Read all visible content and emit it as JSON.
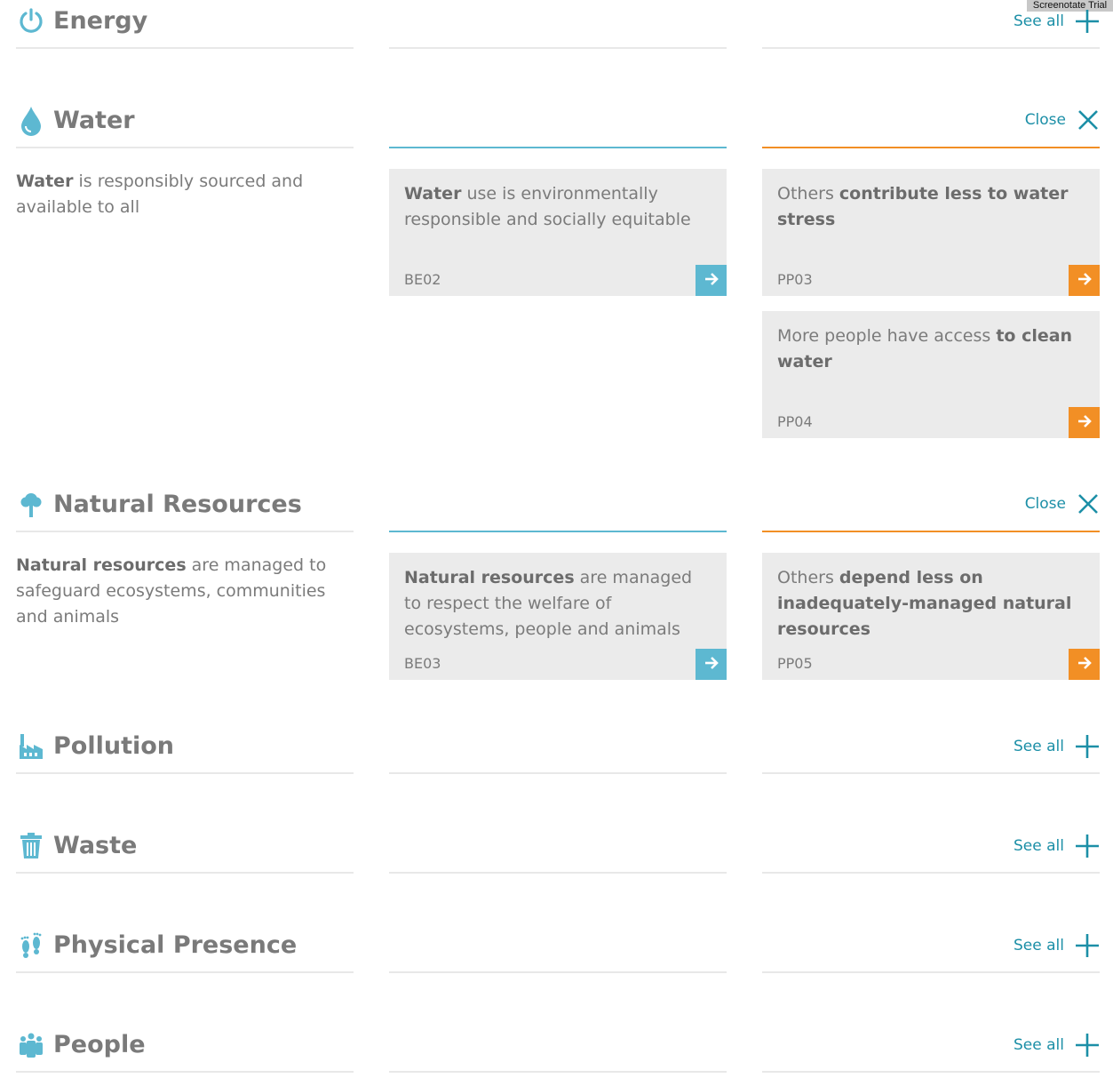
{
  "watermark": "Screenotate Trial",
  "sections": {
    "energy": {
      "title": "Energy",
      "action": "See all",
      "icon": "power-icon"
    },
    "water": {
      "title": "Water",
      "action": "Close",
      "icon": "water-drop-icon",
      "summary": {
        "bold": "Water",
        "rest": " is responsibly sourced and available to all"
      },
      "cards": [
        {
          "pre": "",
          "bold": "Water",
          "post": " use is environmentally responsible and socially equitable",
          "code": "BE02",
          "color": "#5db8d1"
        },
        {
          "pre": "Others ",
          "bold": "contribute less to water stress",
          "post": "",
          "code": "PP03",
          "color": "#f28f25"
        },
        {
          "pre": "More people have access ",
          "bold": "to clean water",
          "post": "",
          "code": "PP04",
          "color": "#f28f25"
        }
      ]
    },
    "natural_resources": {
      "title": "Natural Resources",
      "action": "Close",
      "icon": "tree-icon",
      "summary": {
        "bold": "Natural resources",
        "rest": " are managed to safeguard ecosystems, communities and animals"
      },
      "cards": [
        {
          "pre": "",
          "bold": "Natural resources",
          "post": " are managed to respect the welfare of ecosystems, people and animals",
          "code": "BE03",
          "color": "#5db8d1"
        },
        {
          "pre": "Others ",
          "bold": "depend less on inadequately-managed natural resources",
          "post": "",
          "code": "PP05",
          "color": "#f28f25"
        }
      ]
    },
    "pollution": {
      "title": "Pollution",
      "action": "See all",
      "icon": "factory-icon"
    },
    "waste": {
      "title": "Waste",
      "action": "See all",
      "icon": "trash-bin-icon"
    },
    "physical_presence": {
      "title": "Physical Presence",
      "action": "See all",
      "icon": "footprints-icon"
    },
    "people": {
      "title": "People",
      "action": "See all",
      "icon": "people-group-icon"
    }
  },
  "colors": {
    "accent_teal": "#1c8fa7",
    "icon_blue": "#5db8d1",
    "orange": "#f28f25",
    "card_bg": "#ebebeb",
    "rule_grey": "#e8e8e8"
  }
}
